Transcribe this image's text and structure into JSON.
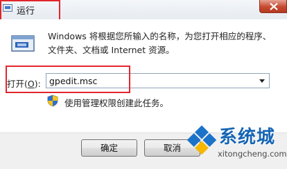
{
  "window": {
    "title": "运行",
    "close_icon": "close-icon"
  },
  "dialog": {
    "description": "Windows 将根据您所输入的名称，为您打开相应的程序、文件夹、文档或 Internet 资源。",
    "open_label_prefix": "打开(",
    "open_label_key": "O",
    "open_label_suffix": "):",
    "input_value": "gpedit.msc",
    "admin_note": "使用管理权限创建此任务。"
  },
  "buttons": {
    "ok": "确定",
    "cancel": "取消"
  },
  "watermark": {
    "brand": "系统城",
    "url": "xitongcheng.com"
  },
  "colors": {
    "highlight": "#e2252c",
    "brand_blue": "#1565b5"
  }
}
